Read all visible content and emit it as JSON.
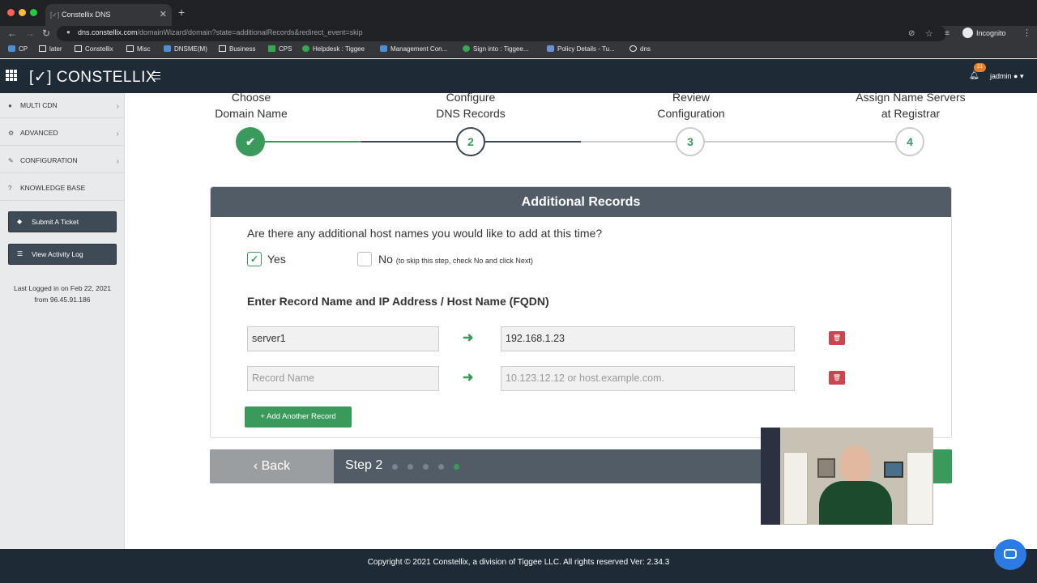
{
  "browser": {
    "tab_title": "Constellix DNS",
    "url_host": "dns.constellix.com",
    "url_path": "/domainWizard/domain?state=additionalRecords&redirect_event=skip",
    "incognito_label": "Incognito",
    "bookmarks": [
      "CP",
      "later",
      "Constellix",
      "Misc",
      "DNSME(M)",
      "Business",
      "CPS",
      "Helpdesk : Tiggee",
      "Management Con...",
      "Sign into : Tiggee...",
      "Policy Details - Tu...",
      "dns"
    ]
  },
  "app": {
    "logo": "[✓] CONSTELLIX",
    "notification_count": "21",
    "user": "jadmin"
  },
  "sidebar": {
    "items": [
      "MULTI CDN",
      "ADVANCED",
      "CONFIGURATION",
      "KNOWLEDGE BASE"
    ],
    "submit_ticket": "Submit A Ticket",
    "activity_log": "View Activity Log",
    "last_logged_line1": "Last Logged in on Feb 22, 2021",
    "last_logged_line2": "from 96.45.91.186"
  },
  "steps": [
    {
      "label_1": "Choose",
      "label_2": "Domain Name",
      "marker": "✔"
    },
    {
      "label_1": "Configure",
      "label_2": "DNS Records",
      "marker": "2"
    },
    {
      "label_1": "Review",
      "label_2": "Configuration",
      "marker": "3"
    },
    {
      "label_1": "Assign Name Servers",
      "label_2": "at Registrar",
      "marker": "4"
    }
  ],
  "panel": {
    "title": "Additional Records",
    "question": "Are there any additional host names you would like to add at this time?",
    "yes_label": "Yes",
    "no_label": "No",
    "no_hint": "(to skip this step, check No and click Next)",
    "section_title": "Enter Record Name and IP Address / Host Name (FQDN)",
    "records": [
      {
        "name": "server1",
        "value": "192.168.1.23"
      }
    ],
    "name_placeholder": "Record Name",
    "value_placeholder": "10.123.12.12 or host.example.com.",
    "add_button": "+ Add Another Record"
  },
  "nav": {
    "back": "‹ Back",
    "step_text": "Step 2",
    "active_dot": 5
  },
  "footer": {
    "copyright": "Copyright © 2021 Constellix, a division of Tiggee LLC.  All rights reserved Ver: 2.34.3"
  }
}
